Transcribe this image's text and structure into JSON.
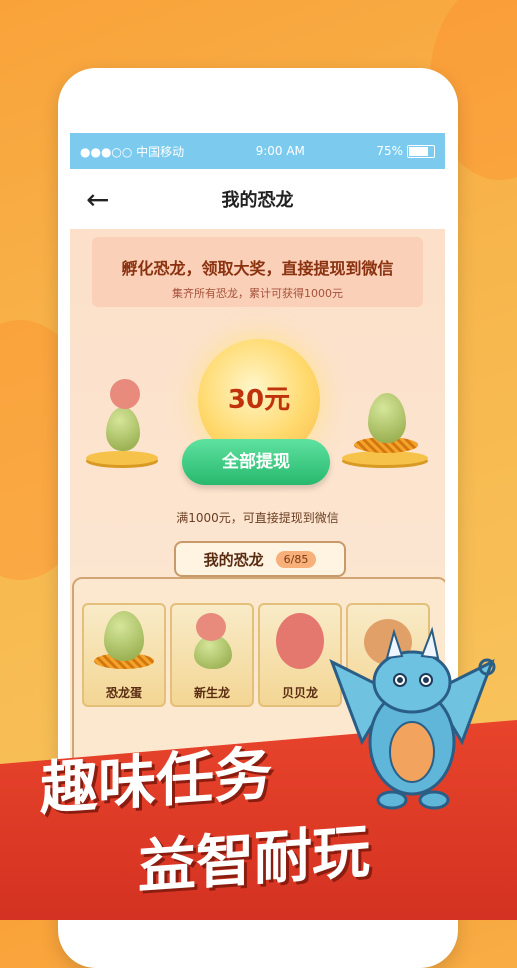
{
  "status_bar": {
    "carrier": "●●●○○ 中国移动",
    "time": "9:00 AM",
    "battery": "75%"
  },
  "nav": {
    "title": "我的恐龙",
    "back_icon": "arrow-left-icon"
  },
  "banner": {
    "headline": "孵化恐龙，领取大奖，直接提现到微信",
    "sub": "集齐所有恐龙，累计可获得1000元"
  },
  "reward": {
    "amount": "30元",
    "button_label": "全部提现",
    "tip": "满1000元，可直接提现到微信"
  },
  "collection": {
    "tab_label": "我的恐龙",
    "count": "6/85",
    "cards": [
      {
        "label": "恐龙蛋"
      },
      {
        "label": "新生龙"
      },
      {
        "label": "贝贝龙"
      },
      {
        "label": ""
      }
    ]
  },
  "promo": {
    "line1": "趣味任务",
    "line2": "益智耐玩"
  },
  "colors": {
    "accent": "#f9a23a",
    "button": "#27b86d",
    "promo_red": "#d43222"
  }
}
